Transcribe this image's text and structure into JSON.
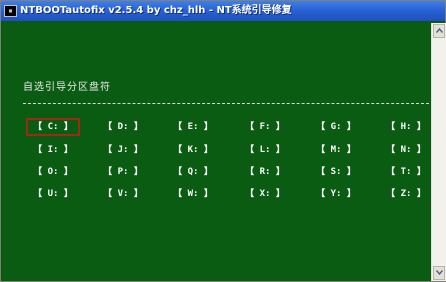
{
  "window": {
    "title": "NTBOOTautofix v2.5.4 by chz_hlh - NT系统引导修复"
  },
  "heading": "自选引导分区盘符",
  "drives": [
    [
      "【 C: 】",
      "【 D: 】",
      "【 E: 】",
      "【 F: 】",
      "【 G: 】",
      "【 H: 】"
    ],
    [
      "【 I: 】",
      "【 J: 】",
      "【 K: 】",
      "【 L: 】",
      "【 M: 】",
      "【 N: 】"
    ],
    [
      "【 O: 】",
      "【 P: 】",
      "【 Q: 】",
      "【 R: 】",
      "【 S: 】",
      "【 T: 】"
    ],
    [
      "【 U: 】",
      "【 V: 】",
      "【 W: 】",
      "【 X: 】",
      "【 Y: 】",
      "【 Z: 】"
    ]
  ],
  "selected_drive": "C:",
  "colors": {
    "background": "#0b5c13",
    "selection_border": "#9e2a14",
    "text": "#ffffff"
  }
}
